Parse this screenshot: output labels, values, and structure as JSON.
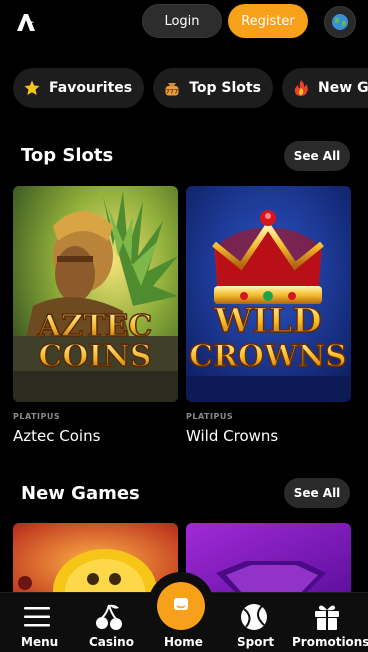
{
  "header": {
    "login_label": "Login",
    "register_label": "Register",
    "logo_icon": "brand-logo",
    "globe_icon": "globe-icon"
  },
  "categories": [
    {
      "label": "Favourites",
      "icon": "star-icon"
    },
    {
      "label": "Top Slots",
      "icon": "slot-bag-icon"
    },
    {
      "label": "New Games",
      "icon": "fire-icon"
    }
  ],
  "top_slots": {
    "title": "Top Slots",
    "see_all_label": "See All",
    "games": [
      {
        "provider": "PLATIPUS",
        "name": "Aztec Coins",
        "art_title_line1": "AZTEC",
        "art_title_line2": "COINS"
      },
      {
        "provider": "PLATIPUS",
        "name": "Wild Crowns",
        "art_title_line1": "WILD",
        "art_title_line2": "CROWNS"
      }
    ]
  },
  "new_games": {
    "title": "New Games",
    "see_all_label": "See All"
  },
  "bottom_nav": {
    "items": [
      {
        "label": "Menu",
        "icon": "hamburger-icon"
      },
      {
        "label": "Casino",
        "icon": "cherries-icon"
      },
      {
        "label": "Home",
        "icon": "home-chat-icon"
      },
      {
        "label": "Sport",
        "icon": "ball-icon"
      },
      {
        "label": "Promotions",
        "icon": "gift-icon"
      }
    ]
  },
  "colors": {
    "accent": "#f7a11a",
    "background": "#000000",
    "chip_bg": "#1d1d1d",
    "button_dark": "#2a2a2a",
    "provider_gray": "#8a8a8a"
  }
}
